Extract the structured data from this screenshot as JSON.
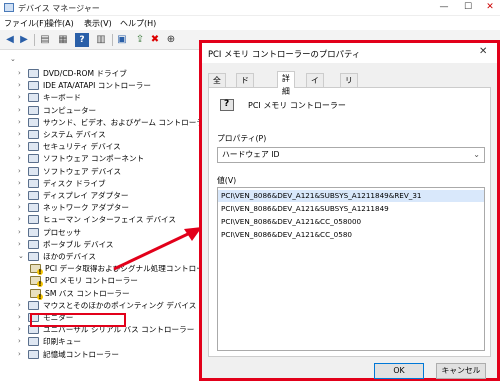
{
  "device_manager": {
    "title": "デバイス マネージャー",
    "menu": [
      "ファイル(F)",
      "操作(A)",
      "表示(V)",
      "ヘルプ(H)"
    ],
    "tree": [
      {
        "label": "DVD/CD-ROM ドライブ",
        "expander": "›",
        "warn": false
      },
      {
        "label": "IDE ATA/ATAPI コントローラー",
        "expander": "›",
        "warn": false
      },
      {
        "label": "キーボード",
        "expander": "›",
        "warn": false
      },
      {
        "label": "コンピューター",
        "expander": "›",
        "warn": false
      },
      {
        "label": "サウンド、ビデオ、およびゲーム コントローラー",
        "expander": "›",
        "warn": false
      },
      {
        "label": "システム デバイス",
        "expander": "›",
        "warn": false
      },
      {
        "label": "セキュリティ デバイス",
        "expander": "›",
        "warn": false
      },
      {
        "label": "ソフトウェア コンポーネント",
        "expander": "›",
        "warn": false
      },
      {
        "label": "ソフトウェア デバイス",
        "expander": "›",
        "warn": false
      },
      {
        "label": "ディスク ドライブ",
        "expander": "›",
        "warn": false
      },
      {
        "label": "ディスプレイ アダプター",
        "expander": "›",
        "warn": false
      },
      {
        "label": "ネットワーク アダプター",
        "expander": "›",
        "warn": false
      },
      {
        "label": "ヒューマン インターフェイス デバイス",
        "expander": "›",
        "warn": false
      },
      {
        "label": "プロセッサ",
        "expander": "›",
        "warn": false
      },
      {
        "label": "ポータブル デバイス",
        "expander": "›",
        "warn": false
      },
      {
        "label": "ほかのデバイス",
        "expander": "⌄",
        "warn": false
      },
      {
        "label": "PCI データ取得およびシグナル処理コントローラー",
        "expander": "",
        "warn": true,
        "child": true
      },
      {
        "label": "PCI メモリ コントローラー",
        "expander": "",
        "warn": true,
        "child": true
      },
      {
        "label": "SM バス コントローラー",
        "expander": "",
        "warn": true,
        "child": true
      },
      {
        "label": "マウスとそのほかのポインティング デバイス",
        "expander": "›",
        "warn": false
      },
      {
        "label": "モニター",
        "expander": "›",
        "warn": false
      },
      {
        "label": "ユニバーサル シリアル バス コントローラー",
        "expander": "›",
        "warn": false
      },
      {
        "label": "印刷キュー",
        "expander": "›",
        "warn": false
      },
      {
        "label": "記憶域コントローラー",
        "expander": "›",
        "warn": false
      }
    ]
  },
  "dialog": {
    "title": "PCI メモリ コントローラーのプロパティ",
    "close": "✕",
    "tabs": [
      "全般",
      "ドライバー",
      "詳細",
      "イベント",
      "リソース"
    ],
    "active_tab": 2,
    "device_name": "PCI メモリ コントローラー",
    "property_label": "プロパティ(P)",
    "property_value": "ハードウェア ID",
    "value_label": "値(V)",
    "values": [
      "PCI\\VEN_8086&DEV_A121&SUBSYS_A1211849&REV_31",
      "PCI\\VEN_8086&DEV_A121&SUBSYS_A1211849",
      "PCI\\VEN_8086&DEV_A121&CC_058000",
      "PCI\\VEN_8086&DEV_A121&CC_0580"
    ],
    "ok_label": "OK",
    "cancel_label": "キャンセル"
  },
  "colors": {
    "highlight": "#e2001a",
    "selection": "#d9e8fb"
  }
}
